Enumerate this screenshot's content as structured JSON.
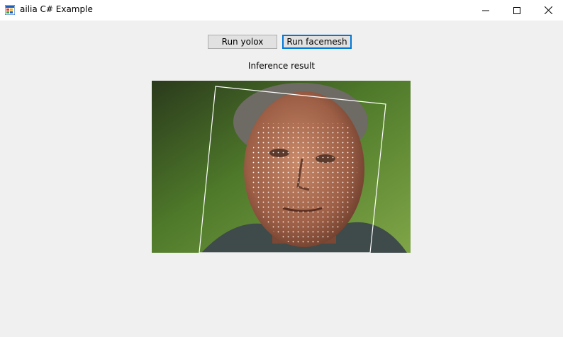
{
  "window": {
    "title": "ailia C# Example",
    "icon": "app-window-icon",
    "controls": [
      "minimize-icon",
      "maximize-icon",
      "close-icon"
    ]
  },
  "buttons": {
    "yolox_label": "Run yolox",
    "facemesh_label": "Run facemesh"
  },
  "result": {
    "label": "Inference result",
    "image": "face-mesh-result-photo"
  },
  "colors": {
    "window_bg": "#f0f0f0",
    "titlebar_bg": "#ffffff",
    "button_bg": "#e1e1e1",
    "focus_border": "#0078d7"
  }
}
